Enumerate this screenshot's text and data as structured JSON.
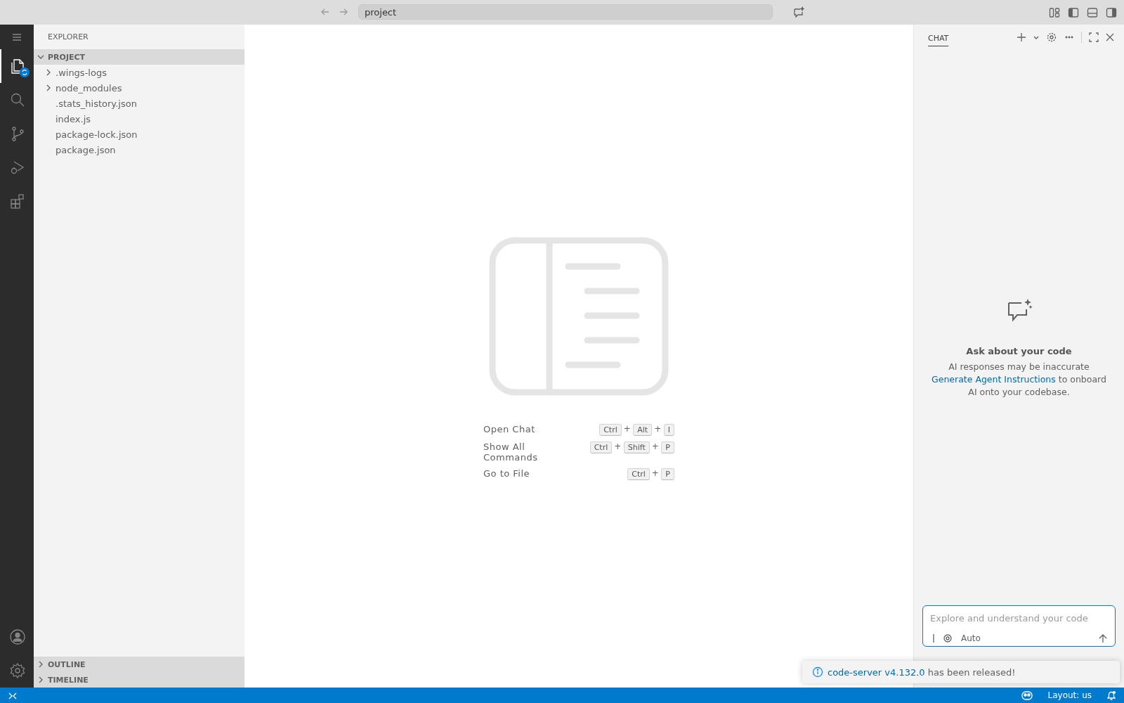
{
  "title_bar": {
    "search": "project",
    "layout_toggles": [
      {
        "kind": "customize"
      },
      {
        "kind": "sidebar",
        "on": true
      },
      {
        "kind": "panel",
        "on": false
      },
      {
        "kind": "secondary",
        "on": true
      }
    ]
  },
  "activity_bar": {
    "items": [
      {
        "kind": "explorer",
        "selected": true,
        "badge": true
      },
      {
        "kind": "search",
        "selected": false,
        "badge": false
      },
      {
        "kind": "source-control",
        "selected": false,
        "badge": false
      },
      {
        "kind": "run",
        "selected": false,
        "badge": false
      },
      {
        "kind": "extensions",
        "selected": false,
        "badge": false
      }
    ],
    "bottom_items": [
      {
        "kind": "account"
      },
      {
        "kind": "settings"
      }
    ]
  },
  "explorer": {
    "title": "EXPLORER",
    "section": {
      "label": "PROJECT",
      "expanded": true,
      "children": [
        {
          "label": ".wings-logs",
          "kind": "folder",
          "expanded": false
        },
        {
          "label": "node_modules",
          "kind": "folder",
          "expanded": false
        },
        {
          "label": ".stats_history.json",
          "kind": "file"
        },
        {
          "label": "index.js",
          "kind": "file"
        },
        {
          "label": "package-lock.json",
          "kind": "file"
        },
        {
          "label": "package.json",
          "kind": "file"
        }
      ]
    },
    "collapsed_sections": [
      {
        "label": "OUTLINE",
        "expanded": false
      },
      {
        "label": "TIMELINE",
        "expanded": false
      }
    ]
  },
  "editor": {
    "shortcuts": [
      {
        "label": "Open Chat",
        "keys": [
          {
            "kind": "key",
            "text": "Ctrl"
          },
          {
            "kind": "plus",
            "text": "+"
          },
          {
            "kind": "key",
            "text": "Alt"
          },
          {
            "kind": "plus",
            "text": "+"
          },
          {
            "kind": "key",
            "text": "I"
          }
        ]
      },
      {
        "label": "Show All Commands",
        "keys": [
          {
            "kind": "key",
            "text": "Ctrl"
          },
          {
            "kind": "plus",
            "text": "+"
          },
          {
            "kind": "key",
            "text": "Shift"
          },
          {
            "kind": "plus",
            "text": "+"
          },
          {
            "kind": "key",
            "text": "P"
          }
        ]
      },
      {
        "label": "Go to File",
        "keys": [
          {
            "kind": "key",
            "text": "Ctrl"
          },
          {
            "kind": "plus",
            "text": "+"
          },
          {
            "kind": "key",
            "text": "P"
          }
        ]
      }
    ]
  },
  "chat": {
    "tab": {
      "label": "CHAT",
      "selected": true
    },
    "heading": "Ask about your code",
    "note": "AI responses may be inaccurate",
    "link": "Generate Agent Instructions",
    "after_link": " to onboard AI onto your codebase.",
    "input": {
      "placeholder": "Explore and understand your code",
      "mode": "Auto"
    }
  },
  "notification": {
    "link": "code-server v4.132.0",
    "text": " has been released!"
  },
  "status_bar": {
    "layout": "Layout: us"
  }
}
